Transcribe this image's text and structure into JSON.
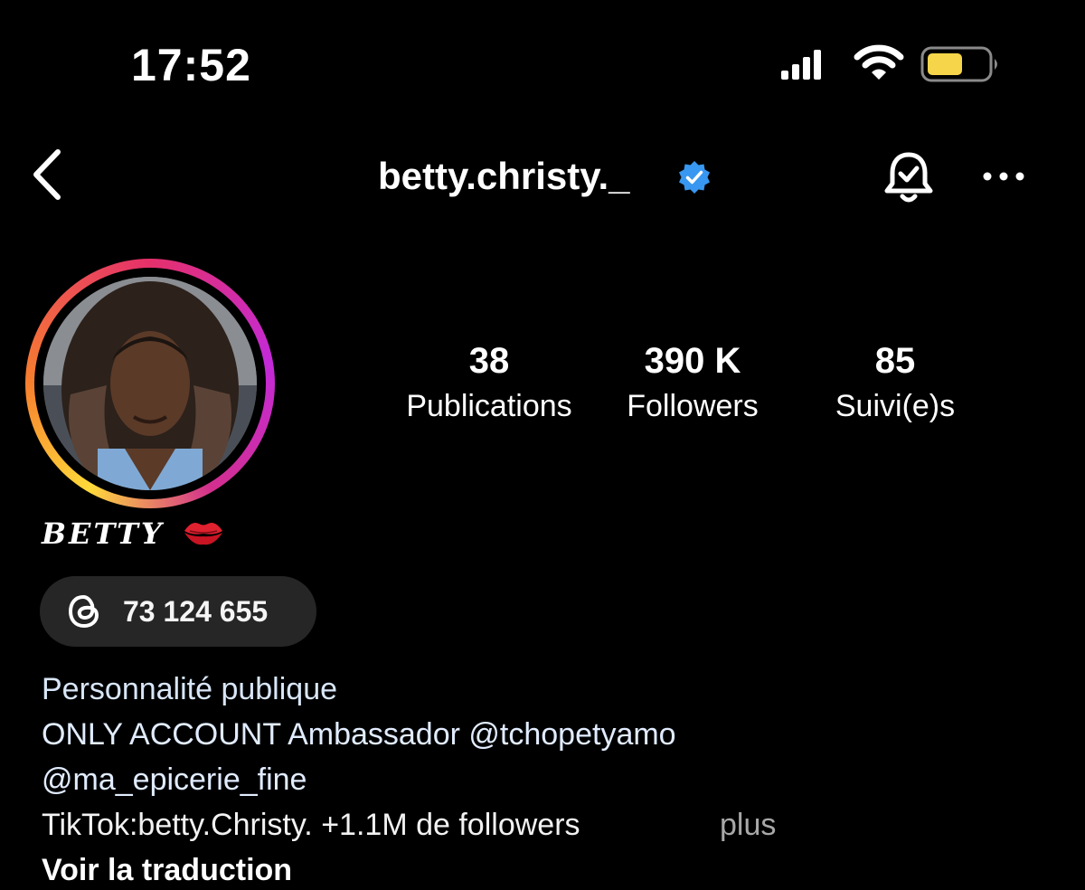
{
  "status_bar": {
    "time": "17:52",
    "icons": [
      "cellular-signal-icon",
      "wifi-icon",
      "battery-icon"
    ],
    "battery_color": "#f7d54a"
  },
  "nav": {
    "back_icon": "chevron-left-icon",
    "username": "betty.christy._",
    "verified_icon": "verified-badge-icon",
    "verified_color": "#3897f0",
    "bell_icon": "notification-bell-check-icon",
    "more_icon": "more-horizontal-icon"
  },
  "profile": {
    "avatar": "profile-photo",
    "display_name": "BETTY",
    "name_emoji": "lips-icon",
    "stats": {
      "posts": {
        "value": "38",
        "label": "Publications"
      },
      "followers": {
        "value": "390 K",
        "label": "Followers"
      },
      "following": {
        "value": "85",
        "label": "Suivi(e)s"
      }
    }
  },
  "threads": {
    "icon": "threads-icon",
    "count": "73 124 655"
  },
  "bio": {
    "category": "Personnalité publique",
    "line1": "ONLY ACCOUNT Ambassador @tchopetyamo",
    "line2": "@ma_epicerie_fine",
    "line3": "TikTok:betty.Christy. +1.1M de followers",
    "more": "plus",
    "translate": "Voir la traduction"
  }
}
